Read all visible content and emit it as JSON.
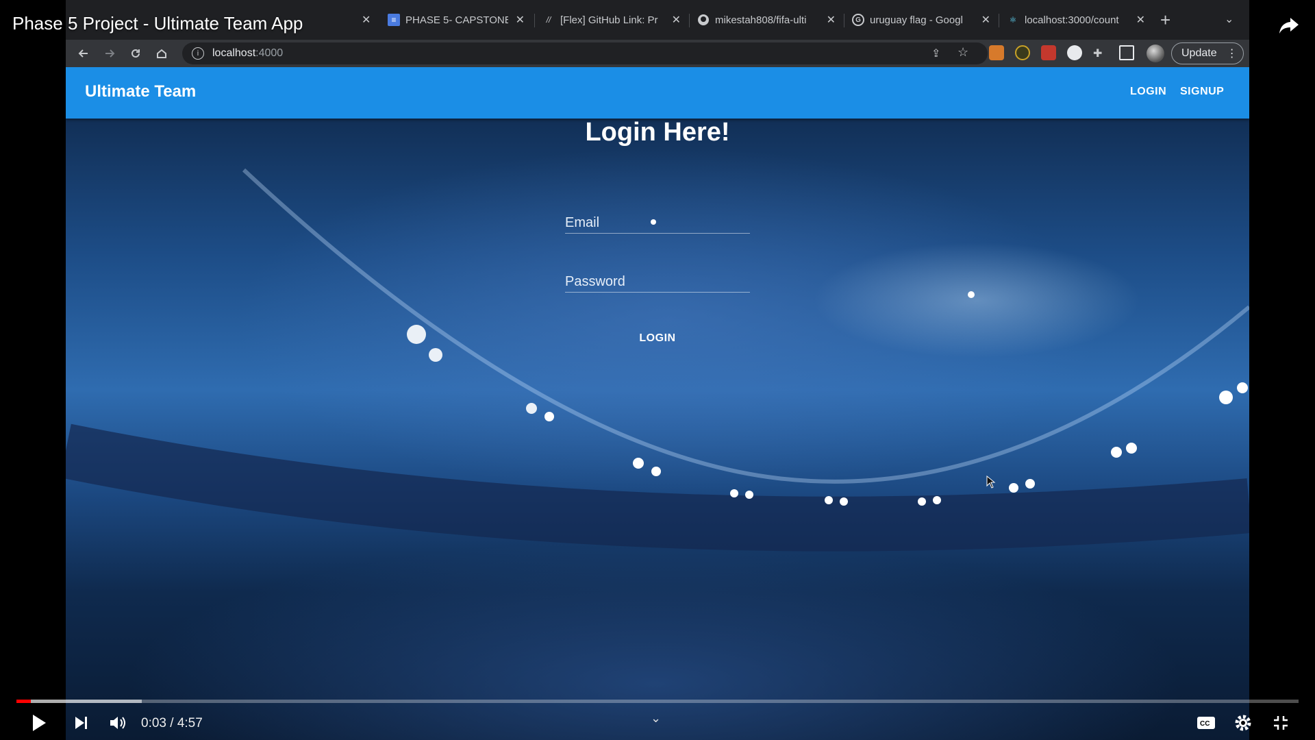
{
  "video": {
    "title": "Phase 5 Project - Ultimate Team App",
    "current_time": "0:03",
    "separator": "/",
    "duration": "4:57",
    "progress_fraction": 0.011,
    "buffered_fraction": 0.098
  },
  "browser": {
    "tabs": [
      {
        "title": "PHASE 5- CAPSTONE",
        "icon": "docs-icon"
      },
      {
        "title": "[Flex] GitHub Link: Pr",
        "icon": "flex-icon"
      },
      {
        "title": "mikestah808/fifa-ulti",
        "icon": "github-icon"
      },
      {
        "title": "uruguay flag - Googl",
        "icon": "google-icon"
      },
      {
        "title": "localhost:3000/count",
        "icon": "react-icon"
      }
    ],
    "url_host": "localhost",
    "url_port": ":4000",
    "update_label": "Update"
  },
  "app": {
    "brand": "Ultimate Team",
    "nav": {
      "login": "LOGIN",
      "signup": "SIGNUP"
    },
    "heading": "Login Here!",
    "email_placeholder": "Email",
    "password_placeholder": "Password",
    "submit_label": "LOGIN",
    "colors": {
      "appbar": "#1b8ee6",
      "progress": "#ff0000"
    }
  }
}
